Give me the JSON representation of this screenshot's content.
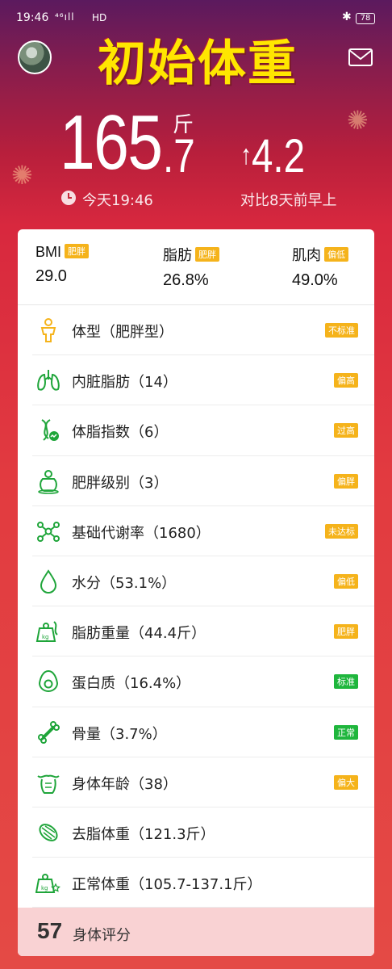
{
  "status_bar": {
    "time": "19:46",
    "signal": "⁴⁶ıll",
    "network": "HD",
    "bluetooth": "✱",
    "battery": "78"
  },
  "header": {
    "title": "初始体重"
  },
  "weight": {
    "integer": "165",
    "decimal": ".7",
    "unit": "斤",
    "change": "4.2",
    "change_arrow": "↑",
    "time_label": "今天19:46",
    "compare_label": "对比8天前早上"
  },
  "summary": [
    {
      "label": "BMI",
      "tag": "肥胖",
      "value": "29.0"
    },
    {
      "label": "脂肪",
      "tag": "肥胖",
      "value": "26.8%"
    },
    {
      "label": "肌肉",
      "tag": "偏低",
      "value": "49.0%"
    }
  ],
  "metrics": [
    {
      "icon": "body-shape-icon",
      "label": "体型（肥胖型）",
      "tag": "不标准",
      "tag_color": "#f5b31b"
    },
    {
      "icon": "lungs-icon",
      "label": "内脏脂肪（14）",
      "tag": "偏高",
      "tag_color": "#f5b31b"
    },
    {
      "icon": "dna-icon",
      "label": "体脂指数（6）",
      "tag": "过高",
      "tag_color": "#f5b31b"
    },
    {
      "icon": "obesity-level-icon",
      "label": "肥胖级别（3）",
      "tag": "偏胖",
      "tag_color": "#f5b31b"
    },
    {
      "icon": "molecule-icon",
      "label": "基础代谢率（1680）",
      "tag": "未达标",
      "tag_color": "#f5b31b"
    },
    {
      "icon": "water-drop-icon",
      "label": "水分（53.1%）",
      "tag": "偏低",
      "tag_color": "#f5b31b"
    },
    {
      "icon": "fat-weight-icon",
      "label": "脂肪重量（44.4斤）",
      "tag": "肥胖",
      "tag_color": "#f5b31b"
    },
    {
      "icon": "avocado-icon",
      "label": "蛋白质（16.4%）",
      "tag": "标准",
      "tag_color": "#1fb63d"
    },
    {
      "icon": "bone-icon",
      "label": "骨量（3.7%）",
      "tag": "正常",
      "tag_color": "#1fb63d"
    },
    {
      "icon": "torso-icon",
      "label": "身体年龄（38）",
      "tag": "偏大",
      "tag_color": "#f5b31b"
    },
    {
      "icon": "muscle-icon",
      "label": "去脂体重（121.3斤）",
      "tag": "",
      "tag_color": ""
    },
    {
      "icon": "ideal-weight-icon",
      "label": "正常体重（105.7-137.1斤）",
      "tag": "",
      "tag_color": ""
    }
  ],
  "score": {
    "value": "57",
    "label": "身体评分"
  },
  "colors": {
    "accent_yellow": "#ffe600",
    "tag_orange": "#f5b31b",
    "tag_green": "#1fb63d",
    "icon_green": "#1fa53a"
  }
}
